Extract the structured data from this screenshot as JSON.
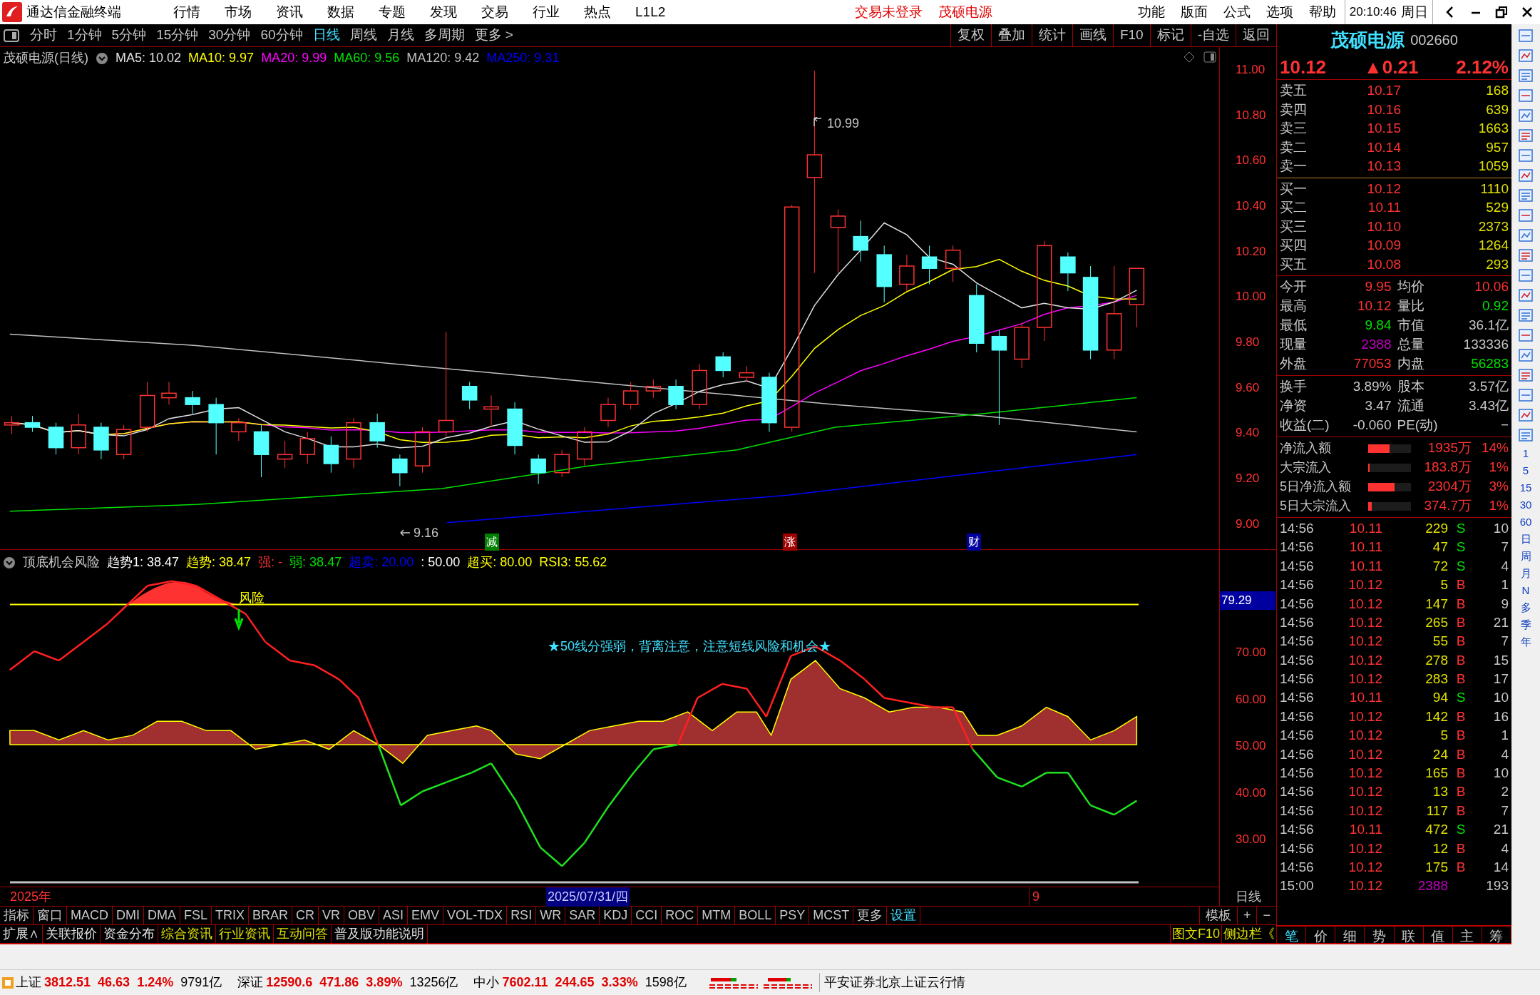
{
  "menu_bar": {
    "app_title": "通达信金融终端",
    "menus": [
      "行情",
      "市场",
      "资讯",
      "数据",
      "专题",
      "发现",
      "交易",
      "行业",
      "热点",
      "L1L2"
    ],
    "login_status": "交易未登录",
    "stock_name": "茂硕电源",
    "right_menus": [
      "功能",
      "版面",
      "公式",
      "选项",
      "帮助"
    ],
    "clock": "20:10:46",
    "weekday": "周日"
  },
  "period_tabs": [
    {
      "label": "分时",
      "selected": false
    },
    {
      "label": "1分钟",
      "selected": false
    },
    {
      "label": "5分钟",
      "selected": false
    },
    {
      "label": "15分钟",
      "selected": false
    },
    {
      "label": "30分钟",
      "selected": false
    },
    {
      "label": "60分钟",
      "selected": false
    },
    {
      "label": "日线",
      "selected": true
    },
    {
      "label": "周线",
      "selected": false
    },
    {
      "label": "月线",
      "selected": false
    },
    {
      "label": "多周期",
      "selected": false
    },
    {
      "label": "更多 >",
      "selected": false
    }
  ],
  "chart_tools": [
    "复权",
    "叠加",
    "统计",
    "画线",
    "F10",
    "标记",
    "-自选",
    "返回"
  ],
  "chart": {
    "title": "茂硕电源(日线)",
    "ma": [
      {
        "label": "MA5: 10.02",
        "color": "#e0e0e0"
      },
      {
        "label": "MA10: 9.97",
        "color": "#ffff00"
      },
      {
        "label": "MA20: 9.99",
        "color": "#ff00ff"
      },
      {
        "label": "MA60: 9.56",
        "color": "#00e000"
      },
      {
        "label": "MA120: 9.42",
        "color": "#c0c0c0"
      },
      {
        "label": "MA250: 9.31",
        "color": "#0000ff"
      }
    ],
    "price_ticks": [
      "11.00",
      "10.80",
      "10.60",
      "10.40",
      "10.20",
      "10.00",
      "9.80",
      "9.60",
      "9.40",
      "9.20",
      "9.00"
    ],
    "high_label": "10.99",
    "low_label": "9.16",
    "events": [
      {
        "label": "减",
        "color": "#008000"
      },
      {
        "label": "涨",
        "color": "#a00000"
      },
      {
        "label": "财",
        "color": "#0000a0"
      }
    ]
  },
  "indicator": {
    "name": "顶底机会风险",
    "readings": [
      {
        "label": "趋势1: 38.47",
        "color": "#ffffff"
      },
      {
        "label": "趋势: 38.47",
        "color": "#ffff00"
      },
      {
        "label": "强: -",
        "color": "#ff3232"
      },
      {
        "label": "弱: 38.47",
        "color": "#00e000"
      },
      {
        "label": "超卖: 20.00",
        "color": "#0000ff"
      },
      {
        "label": ": 50.00",
        "color": "#ffffff"
      },
      {
        "label": "超买: 80.00",
        "color": "#ffff00"
      },
      {
        "label": "RSI3: 55.62",
        "color": "#ffff00"
      }
    ],
    "risk_label": "风险",
    "note": "★50线分强弱，背离注意，注意短线风险和机会★",
    "ticks": [
      "70.00",
      "60.00",
      "50.00",
      "40.00",
      "30.00"
    ],
    "current": "79.29"
  },
  "timeline": {
    "year": "2025年",
    "cursor_date": "2025/07/31/四",
    "month": "9",
    "period": "日线"
  },
  "indicator_tabs": [
    {
      "label": "指标",
      "selected": false
    },
    {
      "label": "窗口",
      "selected": false
    },
    {
      "label": "MACD",
      "selected": false
    },
    {
      "label": "DMI",
      "selected": false
    },
    {
      "label": "DMA",
      "selected": false
    },
    {
      "label": "FSL",
      "selected": false
    },
    {
      "label": "TRIX",
      "selected": false
    },
    {
      "label": "BRAR",
      "selected": false
    },
    {
      "label": "CR",
      "selected": false
    },
    {
      "label": "VR",
      "selected": false
    },
    {
      "label": "OBV",
      "selected": false
    },
    {
      "label": "ASI",
      "selected": false
    },
    {
      "label": "EMV",
      "selected": false
    },
    {
      "label": "VOL-TDX",
      "selected": false
    },
    {
      "label": "RSI",
      "selected": false
    },
    {
      "label": "WR",
      "selected": false
    },
    {
      "label": "SAR",
      "selected": false
    },
    {
      "label": "KDJ",
      "selected": false
    },
    {
      "label": "CCI",
      "selected": false
    },
    {
      "label": "ROC",
      "selected": false
    },
    {
      "label": "MTM",
      "selected": false
    },
    {
      "label": "BOLL",
      "selected": false
    },
    {
      "label": "PSY",
      "selected": false
    },
    {
      "label": "MCST",
      "selected": false
    },
    {
      "label": "更多",
      "selected": false
    },
    {
      "label": "设置",
      "selected": true
    }
  ],
  "template_buttons": [
    "模板",
    "+",
    "−"
  ],
  "extension_tabs": [
    {
      "label": "扩展∧",
      "color": "#e0e0e0"
    },
    {
      "label": "关联报价",
      "color": "#e0e0e0"
    },
    {
      "label": "资金分布",
      "color": "#e0e0e0"
    },
    {
      "label": "综合资讯",
      "color": "#e0e000"
    },
    {
      "label": "行业资讯",
      "color": "#e0e000"
    },
    {
      "label": "互动问答",
      "color": "#e0e000"
    },
    {
      "label": "普及版功能说明",
      "color": "#e0e0e0"
    }
  ],
  "side_links": [
    "图文F10",
    "侧边栏《"
  ],
  "quote": {
    "name": "茂硕电源",
    "code": "002660",
    "price": "10.12",
    "change": "▲0.21",
    "percent": "2.12%",
    "asks": [
      {
        "label": "卖五",
        "price": "10.17",
        "volume": "168"
      },
      {
        "label": "卖四",
        "price": "10.16",
        "volume": "639"
      },
      {
        "label": "卖三",
        "price": "10.15",
        "volume": "1663"
      },
      {
        "label": "卖二",
        "price": "10.14",
        "volume": "957"
      },
      {
        "label": "卖一",
        "price": "10.13",
        "volume": "1059"
      }
    ],
    "bids": [
      {
        "label": "买一",
        "price": "10.12",
        "volume": "1110"
      },
      {
        "label": "买二",
        "price": "10.11",
        "volume": "529"
      },
      {
        "label": "买三",
        "price": "10.10",
        "volume": "2373"
      },
      {
        "label": "买四",
        "price": "10.09",
        "volume": "1264"
      },
      {
        "label": "买五",
        "price": "10.08",
        "volume": "293"
      }
    ],
    "stats": [
      {
        "label": "今开",
        "value": "9.95",
        "color": "#ff3232"
      },
      {
        "label": "均价",
        "value": "10.06",
        "color": "#ff3232"
      },
      {
        "label": "最高",
        "value": "10.12",
        "color": "#ff3232"
      },
      {
        "label": "量比",
        "value": "0.92",
        "color": "#00e000"
      },
      {
        "label": "最低",
        "value": "9.84",
        "color": "#00e000"
      },
      {
        "label": "市值",
        "value": "36.1亿",
        "color": "#c8c8c8"
      },
      {
        "label": "现量",
        "value": "2388",
        "color": "#c000c0"
      },
      {
        "label": "总量",
        "value": "133336",
        "color": "#c8c8c8"
      },
      {
        "label": "外盘",
        "value": "77053",
        "color": "#ff3232"
      },
      {
        "label": "内盘",
        "value": "56283",
        "color": "#00e000"
      }
    ],
    "shares": [
      {
        "label": "换手",
        "value": "3.89%"
      },
      {
        "label": "股本",
        "value": "3.57亿"
      },
      {
        "label": "净资",
        "value": "3.47"
      },
      {
        "label": "流通",
        "value": "3.43亿"
      },
      {
        "label": "收益(二)",
        "value": "-0.060"
      },
      {
        "label": "PE(动)",
        "value": "−"
      }
    ],
    "flows": [
      {
        "label": "净流入额",
        "level": 0.5,
        "amount": "1935万",
        "percent": "14%"
      },
      {
        "label": "大宗流入",
        "level": 0.03,
        "amount": "183.8万",
        "percent": "1%"
      },
      {
        "label": "5日净流入额",
        "level": 0.62,
        "amount": "2304万",
        "percent": "3%"
      },
      {
        "label": "5日大宗流入",
        "level": 0.09,
        "amount": "374.7万",
        "percent": "1%"
      }
    ],
    "ticks": [
      {
        "time": "14:56",
        "price": "10.11",
        "volume": "229",
        "side": "S",
        "count": "10"
      },
      {
        "time": "14:56",
        "price": "10.11",
        "volume": "47",
        "side": "S",
        "count": "7"
      },
      {
        "time": "14:56",
        "price": "10.11",
        "volume": "72",
        "side": "S",
        "count": "4"
      },
      {
        "time": "14:56",
        "price": "10.12",
        "volume": "5",
        "side": "B",
        "count": "1"
      },
      {
        "time": "14:56",
        "price": "10.12",
        "volume": "147",
        "side": "B",
        "count": "9"
      },
      {
        "time": "14:56",
        "price": "10.12",
        "volume": "265",
        "side": "B",
        "count": "21"
      },
      {
        "time": "14:56",
        "price": "10.12",
        "volume": "55",
        "side": "B",
        "count": "7"
      },
      {
        "time": "14:56",
        "price": "10.12",
        "volume": "278",
        "side": "B",
        "count": "15"
      },
      {
        "time": "14:56",
        "price": "10.12",
        "volume": "283",
        "side": "B",
        "count": "17"
      },
      {
        "time": "14:56",
        "price": "10.11",
        "volume": "94",
        "side": "S",
        "count": "10"
      },
      {
        "time": "14:56",
        "price": "10.12",
        "volume": "142",
        "side": "B",
        "count": "16"
      },
      {
        "time": "14:56",
        "price": "10.12",
        "volume": "5",
        "side": "B",
        "count": "1"
      },
      {
        "time": "14:56",
        "price": "10.12",
        "volume": "24",
        "side": "B",
        "count": "4"
      },
      {
        "time": "14:56",
        "price": "10.12",
        "volume": "165",
        "side": "B",
        "count": "10"
      },
      {
        "time": "14:56",
        "price": "10.12",
        "volume": "13",
        "side": "B",
        "count": "2"
      },
      {
        "time": "14:56",
        "price": "10.12",
        "volume": "117",
        "side": "B",
        "count": "7"
      },
      {
        "time": "14:56",
        "price": "10.11",
        "volume": "472",
        "side": "S",
        "count": "21"
      },
      {
        "time": "14:56",
        "price": "10.12",
        "volume": "12",
        "side": "B",
        "count": "4"
      },
      {
        "time": "14:56",
        "price": "10.12",
        "volume": "175",
        "side": "B",
        "count": "14"
      },
      {
        "time": "15:00",
        "price": "10.12",
        "volume": "2388",
        "count": "193"
      }
    ],
    "tabs": [
      {
        "label": "笔",
        "selected": true
      },
      {
        "label": "价",
        "selected": false
      },
      {
        "label": "细",
        "selected": false
      },
      {
        "label": "势",
        "selected": false
      },
      {
        "label": "联",
        "selected": false
      },
      {
        "label": "值",
        "selected": false
      },
      {
        "label": "主",
        "selected": false
      },
      {
        "label": "筹",
        "selected": false
      }
    ]
  },
  "sidebar_periods": [
    "1",
    "5",
    "15",
    "30",
    "60",
    "日",
    "周",
    "月",
    "N",
    "多",
    "季",
    "年"
  ],
  "status_bar": {
    "indices": [
      {
        "name": "上证",
        "value": "3812.51",
        "change": "46.63",
        "percent": "1.24%",
        "turnover": "9791亿"
      },
      {
        "name": "深证",
        "value": "12590.6",
        "change": "471.86",
        "percent": "3.89%",
        "turnover": "13256亿"
      },
      {
        "name": "中小",
        "value": "7602.11",
        "change": "244.65",
        "percent": "3.33%",
        "turnover": "1598亿"
      }
    ],
    "broker": "平安证券北京上证云行情"
  }
}
